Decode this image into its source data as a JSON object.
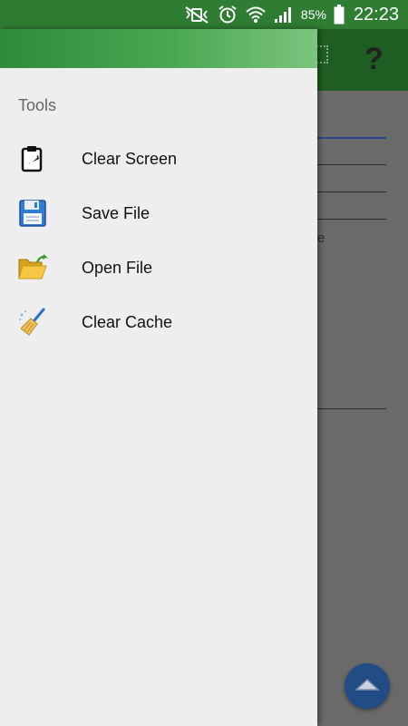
{
  "status_bar": {
    "battery": "85%",
    "time": "22:23",
    "icons": [
      "mute-vibrate-icon",
      "alarm-icon",
      "wifi-icon",
      "signal-icon",
      "battery-icon"
    ]
  },
  "drawer": {
    "section_title": "Tools",
    "items": [
      {
        "label": "Clear Screen",
        "icon": "clipboard-icon"
      },
      {
        "label": "Save File",
        "icon": "floppy-disk-icon"
      },
      {
        "label": "Open File",
        "icon": "open-folder-icon"
      },
      {
        "label": "Clear Cache",
        "icon": "broom-icon"
      }
    ]
  },
  "background": {
    "fragment_text": "e",
    "toolbar_icons": [
      "grid-icon",
      "help-icon"
    ],
    "help_glyph": "?",
    "fab_icon": "chevron-up-icon"
  },
  "colors": {
    "status_bar": "#2e7d32",
    "drawer_bg": "#eeeeee",
    "fab": "#214c86"
  }
}
